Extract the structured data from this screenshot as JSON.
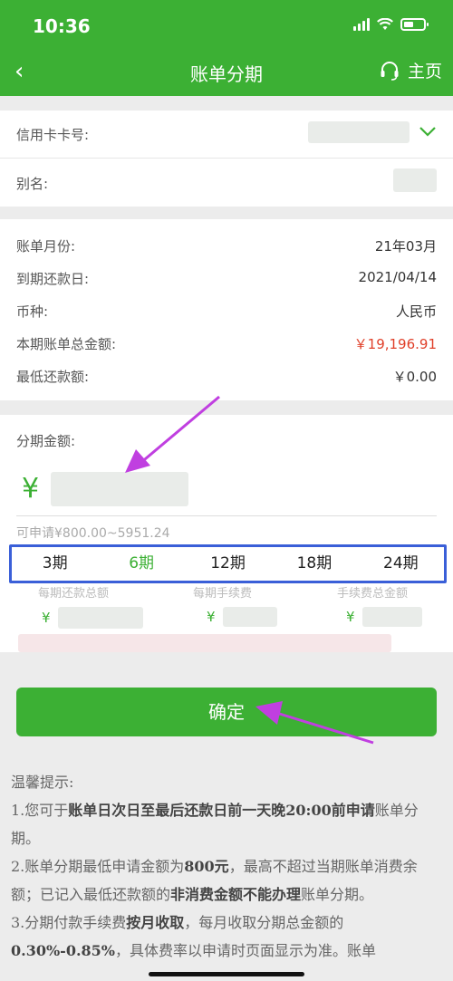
{
  "status_bar": {
    "time": "10:36"
  },
  "nav": {
    "back_icon": "‹",
    "title": "账单分期",
    "home_label": "主页"
  },
  "card_section": {
    "card_number_label": "信用卡卡号:",
    "alias_label": "别名:"
  },
  "bill_info": {
    "rows": [
      {
        "label": "账单月份:",
        "value": "21年03月"
      },
      {
        "label": "到期还款日:",
        "value": "2021/04/14"
      },
      {
        "label": "币种:",
        "value": "人民币"
      },
      {
        "label": "本期账单总金额:",
        "value": "￥19,196.91"
      },
      {
        "label": "最低还款额:",
        "value": "￥0.00"
      }
    ]
  },
  "installment": {
    "amount_label": "分期金额:",
    "currency_symbol": "¥",
    "range_hint": "可申请¥800.00~5951.24",
    "periods": [
      "3期",
      "6期",
      "12期",
      "18期",
      "24期"
    ],
    "selected_period": "6期",
    "sub_labels": [
      "每期还款总额",
      "每期手续费",
      "手续费总金额"
    ],
    "sub_currency": "¥"
  },
  "confirm_label": "确定",
  "tips": {
    "title": "温馨提示:",
    "l1a": "1.您可于",
    "l1b": "账单日次日至最后还款日前一天晚20:00前申请",
    "l1c": "账单分期。",
    "l2a": "2.账单分期最低申请金额为",
    "l2b": "800元",
    "l2c": "，最高不超过当期账单消费余额；已记入最低还款额的",
    "l2d": "非消费金额不能办理",
    "l2e": "账单分期。",
    "l3a": "3.分期付款手续费",
    "l3b": "按月收取",
    "l3c": "，每月收取分期总金额的",
    "l3d": "0.30%-0.85%",
    "l3e": "，具体费率以申请时页面显示为准。账单"
  },
  "colors": {
    "brand_green": "#3cb034",
    "highlight_blue": "#3a5fd8",
    "amount_red": "#e0402a",
    "annotation_arrow": "#c03fe0"
  }
}
